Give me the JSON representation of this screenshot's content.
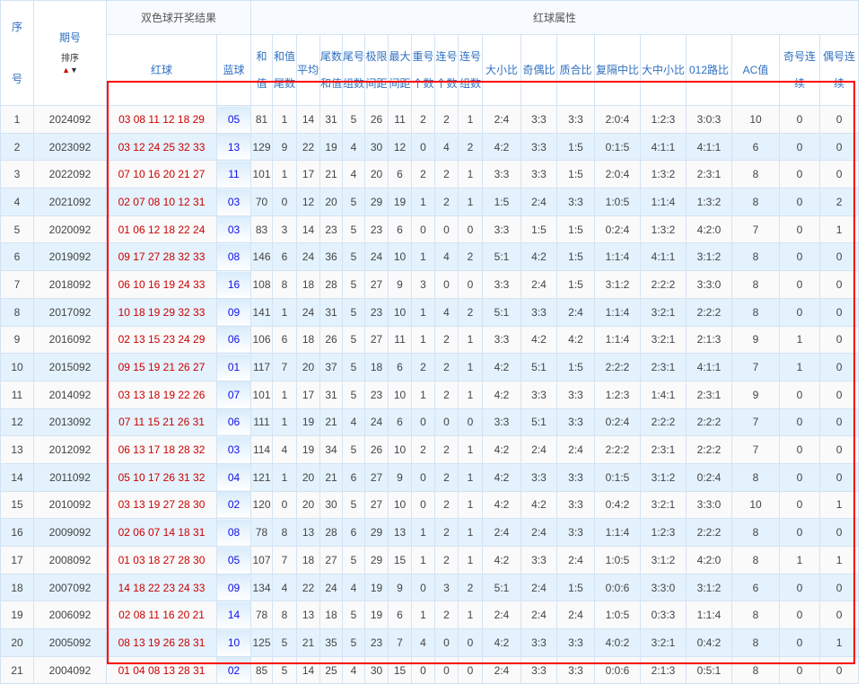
{
  "header": {
    "seq": "序号",
    "issue": "期号",
    "sort": "排序",
    "result_group": "双色球开奖结果",
    "attr_group": "红球属性",
    "red": "红球",
    "blue": "蓝球",
    "cols": [
      "和值",
      "和值尾数",
      "平均值",
      "尾数和值",
      "尾号组数",
      "极限间距",
      "最大间距",
      "重号个数",
      "连号个数",
      "连号组数",
      "大小比",
      "奇偶比",
      "质合比",
      "复隔中比",
      "大中小比",
      "012路比",
      "AC值",
      "奇号连续",
      "偶号连续"
    ]
  },
  "colors": {
    "accent": "#2f6fc0",
    "red_ball": "#cc0000",
    "blue_ball": "#1010e8",
    "highlight": "#ff0000"
  },
  "rows": [
    [
      "1",
      "2024092",
      "03 08 11 12 18 29",
      "05",
      "81",
      "1",
      "14",
      "31",
      "5",
      "26",
      "11",
      "2",
      "2",
      "1",
      "2:4",
      "3:3",
      "3:3",
      "2:0:4",
      "1:2:3",
      "3:0:3",
      "10",
      "0",
      "0"
    ],
    [
      "2",
      "2023092",
      "03 12 24 25 32 33",
      "13",
      "129",
      "9",
      "22",
      "19",
      "4",
      "30",
      "12",
      "0",
      "4",
      "2",
      "4:2",
      "3:3",
      "1:5",
      "0:1:5",
      "4:1:1",
      "4:1:1",
      "6",
      "0",
      "0"
    ],
    [
      "3",
      "2022092",
      "07 10 16 20 21 27",
      "11",
      "101",
      "1",
      "17",
      "21",
      "4",
      "20",
      "6",
      "2",
      "2",
      "1",
      "3:3",
      "3:3",
      "1:5",
      "2:0:4",
      "1:3:2",
      "2:3:1",
      "8",
      "0",
      "0"
    ],
    [
      "4",
      "2021092",
      "02 07 08 10 12 31",
      "03",
      "70",
      "0",
      "12",
      "20",
      "5",
      "29",
      "19",
      "1",
      "2",
      "1",
      "1:5",
      "2:4",
      "3:3",
      "1:0:5",
      "1:1:4",
      "1:3:2",
      "8",
      "0",
      "2"
    ],
    [
      "5",
      "2020092",
      "01 06 12 18 22 24",
      "03",
      "83",
      "3",
      "14",
      "23",
      "5",
      "23",
      "6",
      "0",
      "0",
      "0",
      "3:3",
      "1:5",
      "1:5",
      "0:2:4",
      "1:3:2",
      "4:2:0",
      "7",
      "0",
      "1"
    ],
    [
      "6",
      "2019092",
      "09 17 27 28 32 33",
      "08",
      "146",
      "6",
      "24",
      "36",
      "5",
      "24",
      "10",
      "1",
      "4",
      "2",
      "5:1",
      "4:2",
      "1:5",
      "1:1:4",
      "4:1:1",
      "3:1:2",
      "8",
      "0",
      "0"
    ],
    [
      "7",
      "2018092",
      "06 10 16 19 24 33",
      "16",
      "108",
      "8",
      "18",
      "28",
      "5",
      "27",
      "9",
      "3",
      "0",
      "0",
      "3:3",
      "2:4",
      "1:5",
      "3:1:2",
      "2:2:2",
      "3:3:0",
      "8",
      "0",
      "0"
    ],
    [
      "8",
      "2017092",
      "10 18 19 29 32 33",
      "09",
      "141",
      "1",
      "24",
      "31",
      "5",
      "23",
      "10",
      "1",
      "4",
      "2",
      "5:1",
      "3:3",
      "2:4",
      "1:1:4",
      "3:2:1",
      "2:2:2",
      "8",
      "0",
      "0"
    ],
    [
      "9",
      "2016092",
      "02 13 15 23 24 29",
      "06",
      "106",
      "6",
      "18",
      "26",
      "5",
      "27",
      "11",
      "1",
      "2",
      "1",
      "3:3",
      "4:2",
      "4:2",
      "1:1:4",
      "3:2:1",
      "2:1:3",
      "9",
      "1",
      "0"
    ],
    [
      "10",
      "2015092",
      "09 15 19 21 26 27",
      "01",
      "117",
      "7",
      "20",
      "37",
      "5",
      "18",
      "6",
      "2",
      "2",
      "1",
      "4:2",
      "5:1",
      "1:5",
      "2:2:2",
      "2:3:1",
      "4:1:1",
      "7",
      "1",
      "0"
    ],
    [
      "11",
      "2014092",
      "03 13 18 19 22 26",
      "07",
      "101",
      "1",
      "17",
      "31",
      "5",
      "23",
      "10",
      "1",
      "2",
      "1",
      "4:2",
      "3:3",
      "3:3",
      "1:2:3",
      "1:4:1",
      "2:3:1",
      "9",
      "0",
      "0"
    ],
    [
      "12",
      "2013092",
      "07 11 15 21 26 31",
      "06",
      "111",
      "1",
      "19",
      "21",
      "4",
      "24",
      "6",
      "0",
      "0",
      "0",
      "3:3",
      "5:1",
      "3:3",
      "0:2:4",
      "2:2:2",
      "2:2:2",
      "7",
      "0",
      "0"
    ],
    [
      "13",
      "2012092",
      "06 13 17 18 28 32",
      "03",
      "114",
      "4",
      "19",
      "34",
      "5",
      "26",
      "10",
      "2",
      "2",
      "1",
      "4:2",
      "2:4",
      "2:4",
      "2:2:2",
      "2:3:1",
      "2:2:2",
      "7",
      "0",
      "0"
    ],
    [
      "14",
      "2011092",
      "05 10 17 26 31 32",
      "04",
      "121",
      "1",
      "20",
      "21",
      "6",
      "27",
      "9",
      "0",
      "2",
      "1",
      "4:2",
      "3:3",
      "3:3",
      "0:1:5",
      "3:1:2",
      "0:2:4",
      "8",
      "0",
      "0"
    ],
    [
      "15",
      "2010092",
      "03 13 19 27 28 30",
      "02",
      "120",
      "0",
      "20",
      "30",
      "5",
      "27",
      "10",
      "0",
      "2",
      "1",
      "4:2",
      "4:2",
      "3:3",
      "0:4:2",
      "3:2:1",
      "3:3:0",
      "10",
      "0",
      "1"
    ],
    [
      "16",
      "2009092",
      "02 06 07 14 18 31",
      "08",
      "78",
      "8",
      "13",
      "28",
      "6",
      "29",
      "13",
      "1",
      "2",
      "1",
      "2:4",
      "2:4",
      "3:3",
      "1:1:4",
      "1:2:3",
      "2:2:2",
      "8",
      "0",
      "0"
    ],
    [
      "17",
      "2008092",
      "01 03 18 27 28 30",
      "05",
      "107",
      "7",
      "18",
      "27",
      "5",
      "29",
      "15",
      "1",
      "2",
      "1",
      "4:2",
      "3:3",
      "2:4",
      "1:0:5",
      "3:1:2",
      "4:2:0",
      "8",
      "1",
      "1"
    ],
    [
      "18",
      "2007092",
      "14 18 22 23 24 33",
      "09",
      "134",
      "4",
      "22",
      "24",
      "4",
      "19",
      "9",
      "0",
      "3",
      "2",
      "5:1",
      "2:4",
      "1:5",
      "0:0:6",
      "3:3:0",
      "3:1:2",
      "6",
      "0",
      "0"
    ],
    [
      "19",
      "2006092",
      "02 08 11 16 20 21",
      "14",
      "78",
      "8",
      "13",
      "18",
      "5",
      "19",
      "6",
      "1",
      "2",
      "1",
      "2:4",
      "2:4",
      "2:4",
      "1:0:5",
      "0:3:3",
      "1:1:4",
      "8",
      "0",
      "0"
    ],
    [
      "20",
      "2005092",
      "08 13 19 26 28 31",
      "10",
      "125",
      "5",
      "21",
      "35",
      "5",
      "23",
      "7",
      "4",
      "0",
      "0",
      "4:2",
      "3:3",
      "3:3",
      "4:0:2",
      "3:2:1",
      "0:4:2",
      "8",
      "0",
      "1"
    ],
    [
      "21",
      "2004092",
      "01 04 08 13 28 31",
      "02",
      "85",
      "5",
      "14",
      "25",
      "4",
      "30",
      "15",
      "0",
      "0",
      "0",
      "2:4",
      "3:3",
      "3:3",
      "0:0:6",
      "2:1:3",
      "0:5:1",
      "8",
      "0",
      "0"
    ]
  ]
}
